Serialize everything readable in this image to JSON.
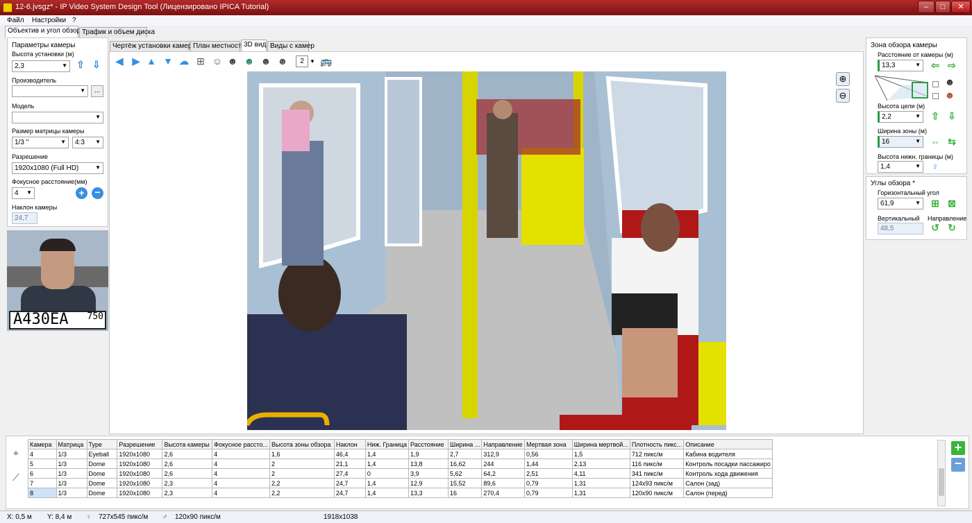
{
  "window": {
    "title": "12-6.jvsgz* - IP Video System Design Tool (Лицензировано  IPICA Tutorial)",
    "minimize": "–",
    "maximize": "□",
    "close": "✕"
  },
  "menu": [
    "Файл",
    "Настройки",
    "?"
  ],
  "main_tabs": [
    "Объектив и угол обзора",
    "Трафик и объем диска"
  ],
  "view_tabs": [
    "Чертёж установки камеры",
    "План местности",
    "3D вид",
    "Виды с камер"
  ],
  "left": {
    "group_title": "Параметры камеры",
    "height_label": "Высота установки (м)",
    "height_value": "2,3",
    "manufacturer_label": "Производитель",
    "manufacturer_value": "",
    "browse_button": "...",
    "model_label": "Модель",
    "model_value": "",
    "sensor_label": "Размер матрицы камеры",
    "sensor_value": "1/3 \"",
    "aspect_value": "4:3",
    "resolution_label": "Разрешение",
    "resolution_value": "1920x1080 (Full HD)",
    "focal_label": "Фокусное расстояние(мм)",
    "focal_value": "4",
    "tilt_label": "Наклон камеры",
    "tilt_value": "24,7",
    "plate_text": "A430EA",
    "plate_region": "750"
  },
  "right": {
    "zone_title": "Зона обзора камеры",
    "distance_label": "Расстояние от камеры (м)",
    "distance_value": "13,3",
    "target_height_label": "Высота цели (м)",
    "target_height_value": "2,2",
    "zone_width_label": "Ширина зоны (м)",
    "zone_width_value": "16",
    "lower_bound_label": "Высота нижн. границы (м)",
    "lower_bound_value": "1,4",
    "angles_title": "Углы обзора *",
    "hangle_label": "Горизонтальный угол",
    "hangle_value": "61,9",
    "vangle_label": "Вертикальный",
    "vangle_value": "48,5",
    "direction_label": "Направление"
  },
  "toolbar": {
    "view_count": "2"
  },
  "table": {
    "headers": [
      "Камера",
      "Матрица",
      "Type",
      "Разрешение",
      "Высота камеры",
      "Фокусное рассто...",
      "Высота зоны обзора",
      "Наклон",
      "Ниж. Граница",
      "Расстояние",
      "Ширина ...",
      "Направление",
      "Мертвая зона",
      "Ширина мертвой...",
      "Плотность пикс...",
      "Описание"
    ],
    "rows": [
      [
        "4",
        "1/3",
        "Eyeball",
        "1920x1080",
        "2,6",
        "4",
        "1,6",
        "46,4",
        "1,4",
        "1,9",
        "2,7",
        "312,9",
        "0,56",
        "1,5",
        "712 пикс/м",
        "Кабина водителя"
      ],
      [
        "5",
        "1/3",
        "Dome",
        "1920x1080",
        "2,6",
        "4",
        "2",
        "21,1",
        "1,4",
        "13,8",
        "16,62",
        "244",
        "1,44",
        "2,13",
        "116 пикс/м",
        "Контроль посадки пассажиро"
      ],
      [
        "6",
        "1/3",
        "Dome",
        "1920x1080",
        "2,6",
        "4",
        "2",
        "27,4",
        "0",
        "3,9",
        "5,62",
        "64,2",
        "2,51",
        "4,11",
        "341 пикс/м",
        "Контроль хода движения"
      ],
      [
        "7",
        "1/3",
        "Dome",
        "1920x1080",
        "2,3",
        "4",
        "2,2",
        "24,7",
        "1,4",
        "12,9",
        "15,52",
        "89,6",
        "0,79",
        "1,31",
        "124x93 пикс/м",
        "Салон (зад)"
      ],
      [
        "8",
        "1/3",
        "Dome",
        "1920x1080",
        "2,3",
        "4",
        "2,2",
        "24,7",
        "1,4",
        "13,3",
        "16",
        "270,4",
        "0,79",
        "1,31",
        "120x90 пикс/м",
        "Салон (перед)"
      ]
    ]
  },
  "status": {
    "x": "X: 0,5 м",
    "y": "Y: 8,4 м",
    "density1": "727x545 пикс/м",
    "density2": "120x90 пикс/м",
    "size": "1918x1038"
  }
}
